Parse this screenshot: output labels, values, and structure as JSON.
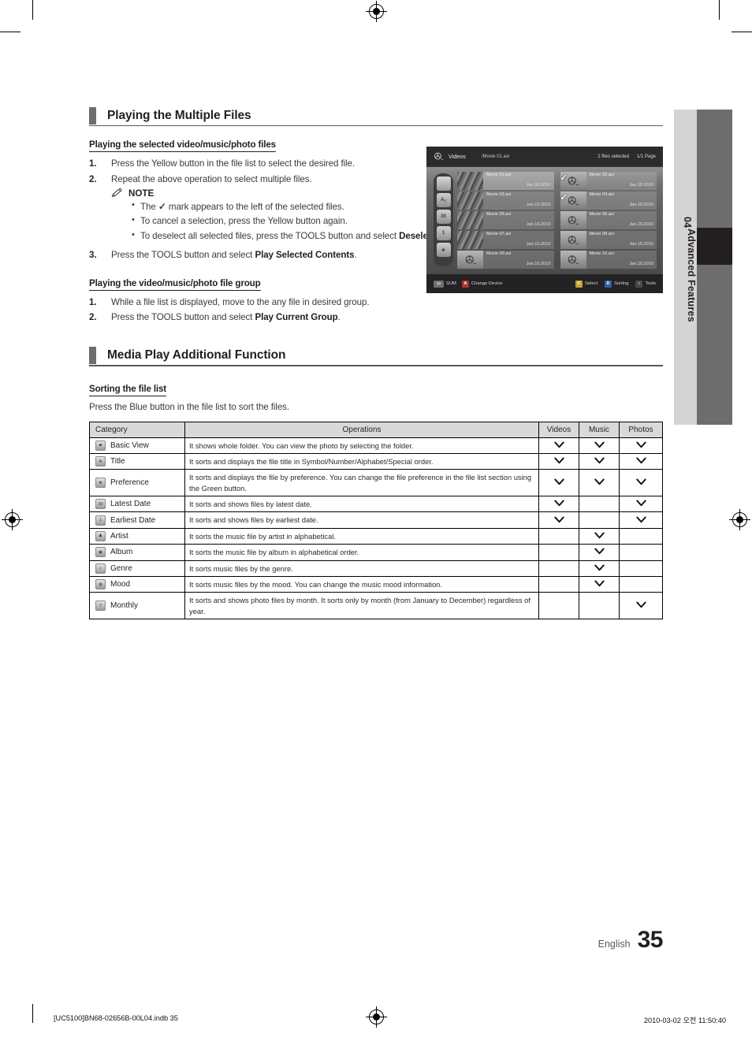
{
  "chapter_tab": {
    "number": "04",
    "label": "Advanced Features"
  },
  "sections": [
    {
      "id": "playing-multiple-files",
      "heading": "Playing the Multiple Files",
      "sub1": {
        "heading": "Playing the selected video/music/photo files",
        "steps": [
          {
            "num": "1.",
            "text": "Press the Yellow button in the file list to select the desired file."
          },
          {
            "num": "2.",
            "text": "Repeat the above operation to select multiple files."
          },
          {
            "num": "3.",
            "text_pre": "Press the TOOLS button and select ",
            "text_bold": "Play Selected Contents",
            "text_post": "."
          }
        ],
        "note": {
          "label": "NOTE",
          "items": [
            {
              "pre": "The ",
              "check": "✓",
              "post": " mark appears to the left of the selected files."
            },
            {
              "pre": "To cancel a selection, press the Yellow button again.",
              "post": ""
            },
            {
              "pre": "To deselect all selected files, press the TOOLS button and select ",
              "bold": "Deselect All",
              "post": "."
            }
          ]
        }
      },
      "sub2": {
        "heading": "Playing the video/music/photo file group",
        "steps": [
          {
            "num": "1.",
            "text": "While a file list is displayed, move to the any file in desired group."
          },
          {
            "num": "2.",
            "text_pre": "Press the TOOLS button and select ",
            "text_bold": "Play Current Group",
            "text_post": "."
          }
        ]
      }
    },
    {
      "id": "media-play-additional",
      "heading": "Media Play Additional Function",
      "sub1": {
        "heading": "Sorting the file list",
        "intro": "Press the Blue button in the file list to sort the files."
      }
    }
  ],
  "tv_screenshot": {
    "header": {
      "icon": "film-reel-icon",
      "title": "Videos",
      "path": "/Movie 01.avi",
      "selected_count": "2 files selected",
      "page": "1/1 Page"
    },
    "sidebar_icons": [
      "folder-icon",
      "title-sort-icon",
      "latest-date-icon",
      "earliest-date-icon",
      "preference-star-icon"
    ],
    "files": [
      {
        "name": "Movie 01.avi",
        "date": "Jan.10.2010",
        "thumb": "photo",
        "checked": false,
        "highlighted": true
      },
      {
        "name": "Movie 02.avi",
        "date": "Jan.10.2010",
        "thumb": "reel",
        "checked": true,
        "highlighted": false
      },
      {
        "name": "Movie 03.avi",
        "date": "Jan.10.2010",
        "thumb": "photo",
        "checked": false,
        "highlighted": false
      },
      {
        "name": "Movie 04.avi",
        "date": "Jan.10.2010",
        "thumb": "reel",
        "checked": true,
        "highlighted": false
      },
      {
        "name": "Movie 05.avi",
        "date": "Jan.10.2010",
        "thumb": "photo",
        "checked": false,
        "highlighted": false
      },
      {
        "name": "Movie 06.avi",
        "date": "Jan.10.2010",
        "thumb": "reel",
        "checked": false,
        "highlighted": false
      },
      {
        "name": "Movie 07.avi",
        "date": "Jan.10.2010",
        "thumb": "photo",
        "checked": false,
        "highlighted": false
      },
      {
        "name": "Movie 08.avi",
        "date": "Jan.10.2010",
        "thumb": "reel",
        "checked": false,
        "highlighted": false
      },
      {
        "name": "Movie 09.avi",
        "date": "Jan.10.2010",
        "thumb": "reel",
        "checked": false,
        "highlighted": false
      },
      {
        "name": "Movie 10.avi",
        "date": "Jan.10.2010",
        "thumb": "reel",
        "checked": false,
        "highlighted": false
      }
    ],
    "footer_left": [
      {
        "key": "",
        "key_icon": "usb-icon",
        "label": "SUM",
        "color": "#6f6f6f"
      },
      {
        "key": "A",
        "label": "Change Device",
        "color": "#b03030"
      }
    ],
    "footer_right": [
      {
        "key": "C",
        "label": "Select",
        "color": "#c8a22a"
      },
      {
        "key": "D",
        "label": "Sorting",
        "color": "#2f5fa8"
      },
      {
        "key": "♪",
        "label": "Tools",
        "color": "#4a4a4a"
      }
    ]
  },
  "sorting_table": {
    "columns": [
      "Category",
      "Operations",
      "Videos",
      "Music",
      "Photos"
    ],
    "rows": [
      {
        "icon": "folder-icon",
        "category": "Basic View",
        "operations": "It shows whole folder. You can view the photo by selecting the folder.",
        "videos": true,
        "music": true,
        "photos": true
      },
      {
        "icon": "title-sort-icon",
        "category": "Title",
        "operations": "It sorts and displays the file title in Symbol/Number/Alphabet/Special order.",
        "videos": true,
        "music": true,
        "photos": true
      },
      {
        "icon": "preference-star-icon",
        "category": "Preference",
        "operations": "It sorts and displays the file by preference. You can change the file preference in the file list section using the Green button.",
        "videos": true,
        "music": true,
        "photos": true
      },
      {
        "icon": "latest-date-icon",
        "category": "Latest Date",
        "operations": "It sorts and shows files by latest date.",
        "videos": true,
        "music": false,
        "photos": true
      },
      {
        "icon": "earliest-date-icon",
        "category": "Earliest Date",
        "operations": "It sorts and shows files by earliest date.",
        "videos": true,
        "music": false,
        "photos": true
      },
      {
        "icon": "artist-icon",
        "category": "Artist",
        "operations": "It sorts the music file by artist in alphabetical.",
        "videos": false,
        "music": true,
        "photos": false
      },
      {
        "icon": "album-icon",
        "category": "Album",
        "operations": "It sorts the music file by album in alphabetical order.",
        "videos": false,
        "music": true,
        "photos": false
      },
      {
        "icon": "genre-icon",
        "category": "Genre",
        "operations": "It sorts music files by the genre.",
        "videos": false,
        "music": true,
        "photos": false
      },
      {
        "icon": "mood-icon",
        "category": "Mood",
        "operations": "It sorts music files by the mood. You can change the music mood information.",
        "videos": false,
        "music": true,
        "photos": false
      },
      {
        "icon": "monthly-icon",
        "category": "Monthly",
        "operations": "It sorts and shows photo files by month. It sorts only by month (from January to December) regardless of year.",
        "videos": false,
        "music": false,
        "photos": true
      }
    ],
    "mark": "∨"
  },
  "page_footer": {
    "language": "English",
    "page_number": "35",
    "print_file": "[UC5100]BN68-02656B-00L04.indb   35",
    "print_timestamp": "2010-03-02   오전 11:50:40"
  }
}
